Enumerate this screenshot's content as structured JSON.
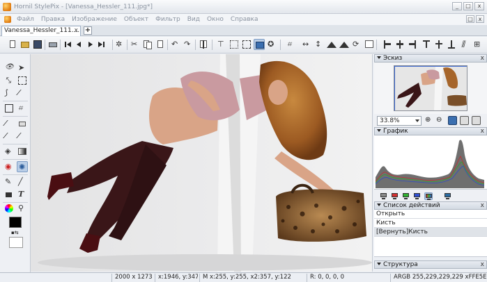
{
  "window": {
    "title": "Hornil StylePix - [Vanessa_Hessler_111.jpg*]",
    "minimize": "_",
    "maximize": "□",
    "close": "x"
  },
  "menu": {
    "items": [
      "Файл",
      "Правка",
      "Изображение",
      "Объект",
      "Фильтр",
      "Вид",
      "Окно",
      "Справка"
    ],
    "restore": "□",
    "close": "x"
  },
  "tabs": {
    "active_label": "Vanessa_Hessler_111....",
    "close": "x",
    "add": "+"
  },
  "panels": {
    "thumbnail_title": "Эскиз",
    "zoom_value": "33.8%",
    "histogram_title": "График",
    "actions_title": "Список действий",
    "actions": [
      "Открыть",
      "Кисть",
      "[Вернуть]Кисть"
    ],
    "structure_title": "Структура",
    "close": "x"
  },
  "status": {
    "size": "2000 x 1273",
    "cursor": "x:1946, y:347",
    "selection": "M x:255, y:255, x2:357, y:122",
    "rgba": "R: 0, 0, 0, 0",
    "argb": "ARGB 255,229,229,229 xFFE5E5E5"
  },
  "colors": {
    "accent": "#3b6fb0",
    "foreground": "#000000",
    "background": "#ffffff"
  }
}
